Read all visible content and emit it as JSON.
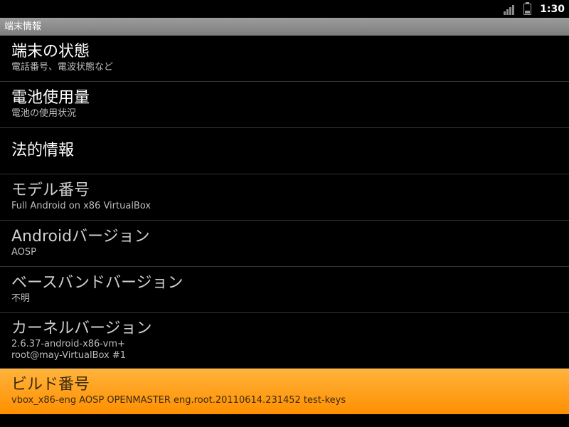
{
  "status_bar": {
    "time": "1:30",
    "icons": [
      "signal-icon",
      "battery-icon"
    ]
  },
  "title_bar": {
    "title": "端末情報"
  },
  "colors": {
    "selected_highlight": "#ff9f1a",
    "title_bar": "#8c8c8c",
    "background": "#000000"
  },
  "items": [
    {
      "title": "端末の状態",
      "summary": "電話番号、電波状態など"
    },
    {
      "title": "電池使用量",
      "summary": "電池の使用状況"
    },
    {
      "title": "法的情報"
    },
    {
      "title": "モデル番号",
      "summary": "Full Android on x86 VirtualBox"
    },
    {
      "title": "Androidバージョン",
      "summary": "AOSP"
    },
    {
      "title": "ベースバンドバージョン",
      "summary": "不明"
    },
    {
      "title": "カーネルバージョン",
      "summary_lines": [
        "2.6.37-android-x86-vm+",
        "root@may-VirtualBox #1"
      ]
    },
    {
      "title": "ビルド番号",
      "summary": "vbox_x86-eng AOSP OPENMASTER eng.root.20110614.231452 test-keys"
    }
  ]
}
